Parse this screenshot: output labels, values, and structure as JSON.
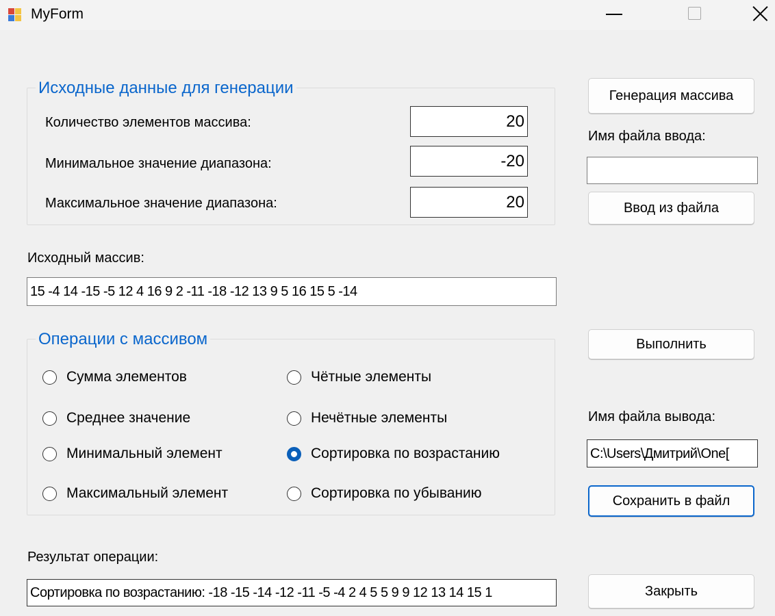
{
  "window": {
    "title": "MyForm"
  },
  "generation": {
    "legend": "Исходные данные для генерации",
    "count_label": "Количество элементов массива:",
    "count_value": "20",
    "min_label": "Минимальное значение диапазона:",
    "min_value": "-20",
    "max_label": "Максимальное значение диапазона:",
    "max_value": "20"
  },
  "right_top": {
    "generate_label": "Генерация массива",
    "input_file_label": "Имя файла ввода:",
    "input_file_value": "",
    "load_label": "Ввод из файла"
  },
  "source": {
    "label": "Исходный массив:",
    "value": "15 -4 14 -15 -5 12 4 16 9 2 -11 -18 -12 13 9 5 16 15 5 -14"
  },
  "operations": {
    "legend": "Операции с массивом",
    "options": [
      {
        "label": "Сумма элементов",
        "checked": false
      },
      {
        "label": "Чётные элементы",
        "checked": false
      },
      {
        "label": "Среднее значение",
        "checked": false
      },
      {
        "label": "Нечётные элементы",
        "checked": false
      },
      {
        "label": "Минимальный элемент",
        "checked": false
      },
      {
        "label": "Сортировка по возрастанию",
        "checked": true
      },
      {
        "label": "Максимальный элемент",
        "checked": false
      },
      {
        "label": "Сортировка по убыванию",
        "checked": false
      }
    ]
  },
  "right_bottom": {
    "execute_label": "Выполнить",
    "output_file_label": "Имя файла вывода:",
    "output_file_value": "C:\\Users\\Дмитрий\\One[",
    "save_label": "Сохранить в файл",
    "close_label": "Закрыть"
  },
  "result": {
    "label": "Результат операции:",
    "value": "Сортировка по возрастанию: -18 -15 -14 -12 -11 -5 -4 2 4 5 5 9 9 12 13 14 15 1"
  },
  "colors": {
    "accent": "#0a66cc",
    "radio_checked": "#0a5fb9"
  }
}
